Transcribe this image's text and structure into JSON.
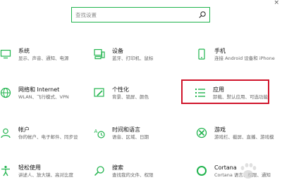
{
  "window": {
    "close_glyph": "×"
  },
  "search": {
    "placeholder": "查找设置"
  },
  "tiles": [
    {
      "title": "系统",
      "subtitle": "显示、声音、通知、电源",
      "icon": "monitor-icon"
    },
    {
      "title": "设备",
      "subtitle": "蓝牙、打印机、鼠标",
      "icon": "devices-icon"
    },
    {
      "title": "手机",
      "subtitle": "连接 Android 设备和 iPhone",
      "icon": "phone-icon"
    },
    {
      "title": "网络和 Internet",
      "subtitle": "WLAN、飞行模式、VPN",
      "icon": "globe-icon"
    },
    {
      "title": "个性化",
      "subtitle": "背景、锁屏、颜色",
      "icon": "personalization-icon"
    },
    {
      "title": "应用",
      "subtitle": "卸载、默认应用、可选功能",
      "icon": "apps-list-icon"
    },
    {
      "title": "帐户",
      "subtitle": "你的帐户、电子邮件、同步设",
      "icon": "account-icon"
    },
    {
      "title": "时间和语言",
      "subtitle": "语音、区域、日期",
      "icon": "time-language-icon"
    },
    {
      "title": "游戏",
      "subtitle": "游戏栏、截屏、直播、游戏模",
      "icon": "xbox-icon"
    },
    {
      "title": "轻松使用",
      "subtitle": "讲述人、放大镜、高对比度",
      "icon": "ease-of-access-icon"
    },
    {
      "title": "搜索",
      "subtitle": "查找我的文件、权限",
      "icon": "search-icon"
    },
    {
      "title": "Cortana",
      "subtitle": "Cortana 语言、权限、通知",
      "icon": "cortana-icon"
    }
  ],
  "highlight": {
    "tile": "应用",
    "color": "#d0142a"
  },
  "colors": {
    "accent": "#1fb34c",
    "text": "#111111",
    "subtext": "#666666"
  }
}
